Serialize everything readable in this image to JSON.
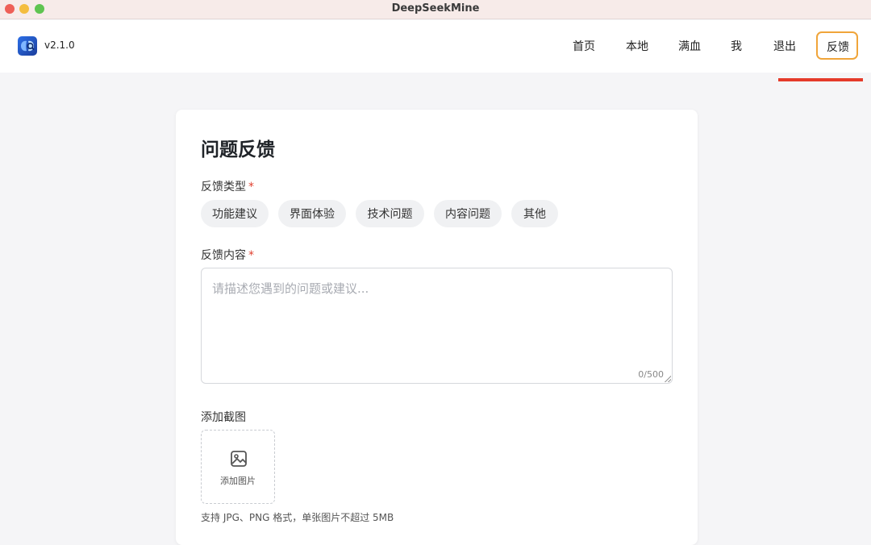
{
  "window": {
    "title": "DeepSeekMine"
  },
  "header": {
    "version": "v2.1.0",
    "nav": [
      {
        "label": "首页"
      },
      {
        "label": "本地"
      },
      {
        "label": "满血"
      },
      {
        "label": "我"
      },
      {
        "label": "退出"
      },
      {
        "label": "反馈",
        "active": true
      }
    ],
    "highlight_color": "#f0a53a",
    "underline_color": "#e53b2a"
  },
  "form": {
    "title": "问题反馈",
    "type_label": "反馈类型",
    "required_mark": "*",
    "types": [
      "功能建议",
      "界面体验",
      "技术问题",
      "内容问题",
      "其他"
    ],
    "content_label": "反馈内容",
    "content_placeholder": "请描述您遇到的问题或建议...",
    "content_counter": "0/500",
    "screenshot_label": "添加截图",
    "upload_label": "添加图片",
    "upload_icon": "image-icon",
    "hint": "支持 JPG、PNG 格式，单张图片不超过 5MB"
  }
}
